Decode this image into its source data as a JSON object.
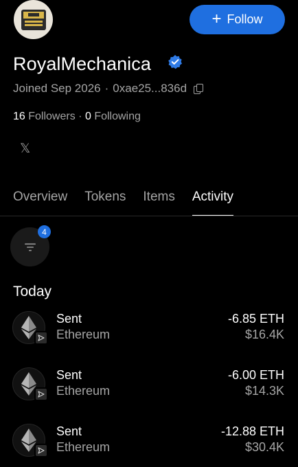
{
  "profile": {
    "avatar_icon": "typewriter-avatar-icon",
    "name": "RoyalMechanica",
    "verified_icon": "verified-badge-icon",
    "joined": "Joined Sep 2026",
    "separator": "·",
    "address": "0xae25...836d",
    "copy_icon": "copy-icon"
  },
  "follow_button": {
    "label": "Follow",
    "icon": "plus-icon",
    "color": "#1f6fe0"
  },
  "stats": {
    "followers_count": "16",
    "followers_label": "Followers",
    "separator": "·",
    "following_count": "0",
    "following_label": "Following"
  },
  "social": {
    "x_icon": "x-logo-icon",
    "glyph": "𝕏"
  },
  "tabs": [
    {
      "label": "Overview",
      "active": false
    },
    {
      "label": "Tokens",
      "active": false
    },
    {
      "label": "Items",
      "active": false
    },
    {
      "label": "Activity",
      "active": true
    }
  ],
  "filter": {
    "icon": "filter-icon",
    "badge_count": "4"
  },
  "activity": {
    "section_title": "Today",
    "items": [
      {
        "type": "Sent",
        "asset": "Ethereum",
        "amount": "-6.85 ETH",
        "usd": "$16.4K",
        "icon": "ethereum-icon",
        "badge_icon": "send-icon"
      },
      {
        "type": "Sent",
        "asset": "Ethereum",
        "amount": "-6.00 ETH",
        "usd": "$14.3K",
        "icon": "ethereum-icon",
        "badge_icon": "send-icon"
      },
      {
        "type": "Sent",
        "asset": "Ethereum",
        "amount": "-12.88 ETH",
        "usd": "$30.4K",
        "icon": "ethereum-icon",
        "badge_icon": "send-icon"
      }
    ]
  },
  "colors": {
    "background": "#000000",
    "accent": "#1f6fe0",
    "muted_text": "#a5a5a5"
  }
}
